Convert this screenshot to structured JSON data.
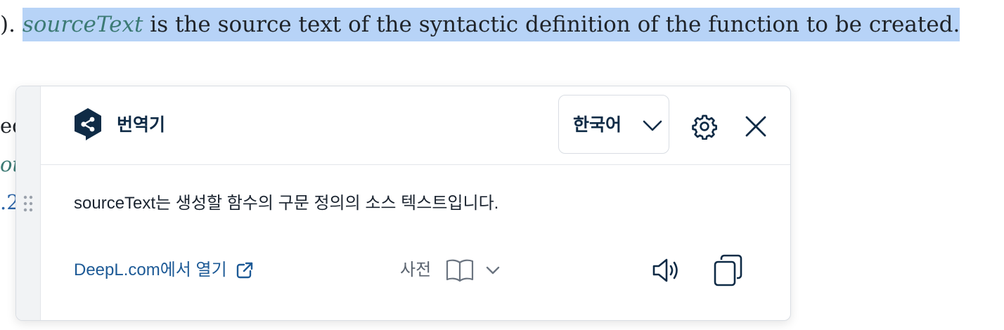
{
  "document": {
    "line_prefix": ").",
    "line_var": "sourceText",
    "line_rest": " is the source text of the syntactic definition of the function to be created.",
    "frag_1": "ed",
    "frag_2": "ot",
    "frag_3": ".2"
  },
  "popup": {
    "title": "번역기",
    "language": "한국어",
    "translation": "sourceText는 생성할 함수의 구문 정의의 소스 텍스트입니다.",
    "open_link": "DeepL.com에서 열기",
    "dictionary_label": "사전"
  },
  "icons": {
    "logo": "deepl-logo-icon",
    "language_chevron": "chevron-down-icon",
    "settings": "gear-icon",
    "close": "close-icon",
    "drag": "drag-handle-icon",
    "external_link": "external-link-icon",
    "dictionary": "book-icon",
    "dictionary_chevron": "chevron-down-icon",
    "speaker": "speaker-icon",
    "copy": "copy-icon"
  },
  "colors": {
    "selection_highlight": "#b7d3f7",
    "code_variable": "#3c7a74",
    "brand_navy": "#0f2b46",
    "link": "#1d5a96"
  }
}
